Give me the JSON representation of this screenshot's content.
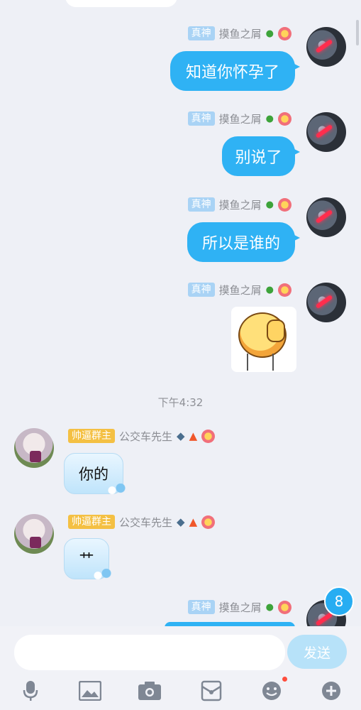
{
  "messages": [
    {
      "tag": "真神",
      "name": "摸鱼之屑",
      "text": "知道你怀孕了"
    },
    {
      "tag": "真神",
      "name": "摸鱼之屑",
      "text": "别说了"
    },
    {
      "tag": "真神",
      "name": "摸鱼之屑",
      "text": "所以是谁的"
    },
    {
      "tag": "真神",
      "name": "摸鱼之屑",
      "sticker": "smiley-sticker"
    },
    {
      "tag": "帅逼群主",
      "name": "公交车先生",
      "text": "你的"
    },
    {
      "tag": "帅逼群主",
      "name": "公交车先生",
      "text": "艹"
    },
    {
      "tag": "真神",
      "name": "摸鱼之屑"
    }
  ],
  "timestamp": "下午4:32",
  "unread_badge": "8",
  "composer": {
    "placeholder": "",
    "send_label": "发送"
  },
  "toolbar": [
    "microphone-icon",
    "image-icon",
    "camera-icon",
    "red-packet-icon",
    "emoji-icon",
    "plus-icon"
  ],
  "colors": {
    "bubble_blue": "#2fb2f4",
    "tag_blue": "#a9d3f5",
    "tag_gold": "#f4c043",
    "badge": "#27adf2"
  }
}
